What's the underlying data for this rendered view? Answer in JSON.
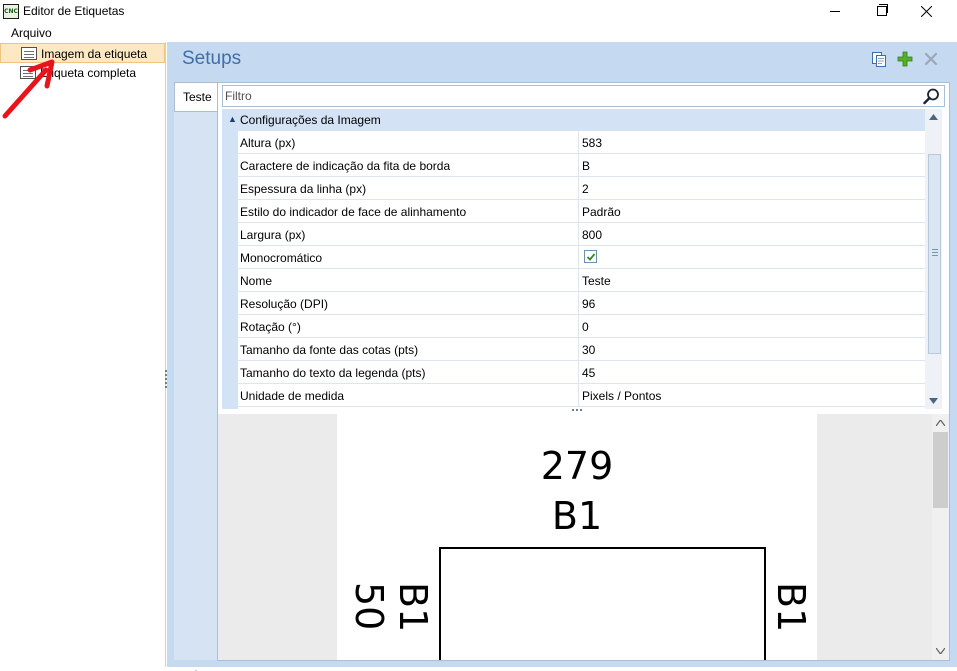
{
  "window": {
    "title": "Editor de Etiquetas",
    "app_icon_text": "CNC"
  },
  "menu": {
    "items": [
      "Arquivo"
    ]
  },
  "tree": {
    "items": [
      {
        "label": "Imagem da etiqueta",
        "selected": true
      },
      {
        "label": "Etiqueta completa",
        "selected": false
      }
    ]
  },
  "setups": {
    "title": "Setups",
    "tabs": [
      "Teste"
    ]
  },
  "filter": {
    "placeholder": "Filtro",
    "value": ""
  },
  "property_grid": {
    "category": "Configurações da Imagem",
    "rows": [
      {
        "name": "Altura (px)",
        "value": "583"
      },
      {
        "name": "Caractere de indicação da fita de borda",
        "value": "B"
      },
      {
        "name": "Espessura da linha (px)",
        "value": "2"
      },
      {
        "name": "Estilo do indicador de face de alinhamento",
        "value": "Padrão"
      },
      {
        "name": "Largura (px)",
        "value": "800"
      },
      {
        "name": "Monocromático",
        "value": "",
        "checked": true
      },
      {
        "name": "Nome",
        "value": "Teste"
      },
      {
        "name": "Resolução (DPI)",
        "value": "96"
      },
      {
        "name": "Rotação (°)",
        "value": "0"
      },
      {
        "name": "Tamanho da fonte das cotas (pts)",
        "value": "30"
      },
      {
        "name": "Tamanho do texto da legenda (pts)",
        "value": "45"
      },
      {
        "name": "Unidade de medida",
        "value": "Pixels / Pontos"
      }
    ]
  },
  "preview": {
    "width_dimension": "279",
    "height_dimension": "50",
    "edge_top": "B1",
    "edge_left": "B1",
    "edge_right": "B1"
  },
  "colors": {
    "accent": "#3f6fa8",
    "panel_bg": "#c5d9f1",
    "selection_bg": "#fde8c4",
    "annotation_arrow": "#e8141c"
  }
}
